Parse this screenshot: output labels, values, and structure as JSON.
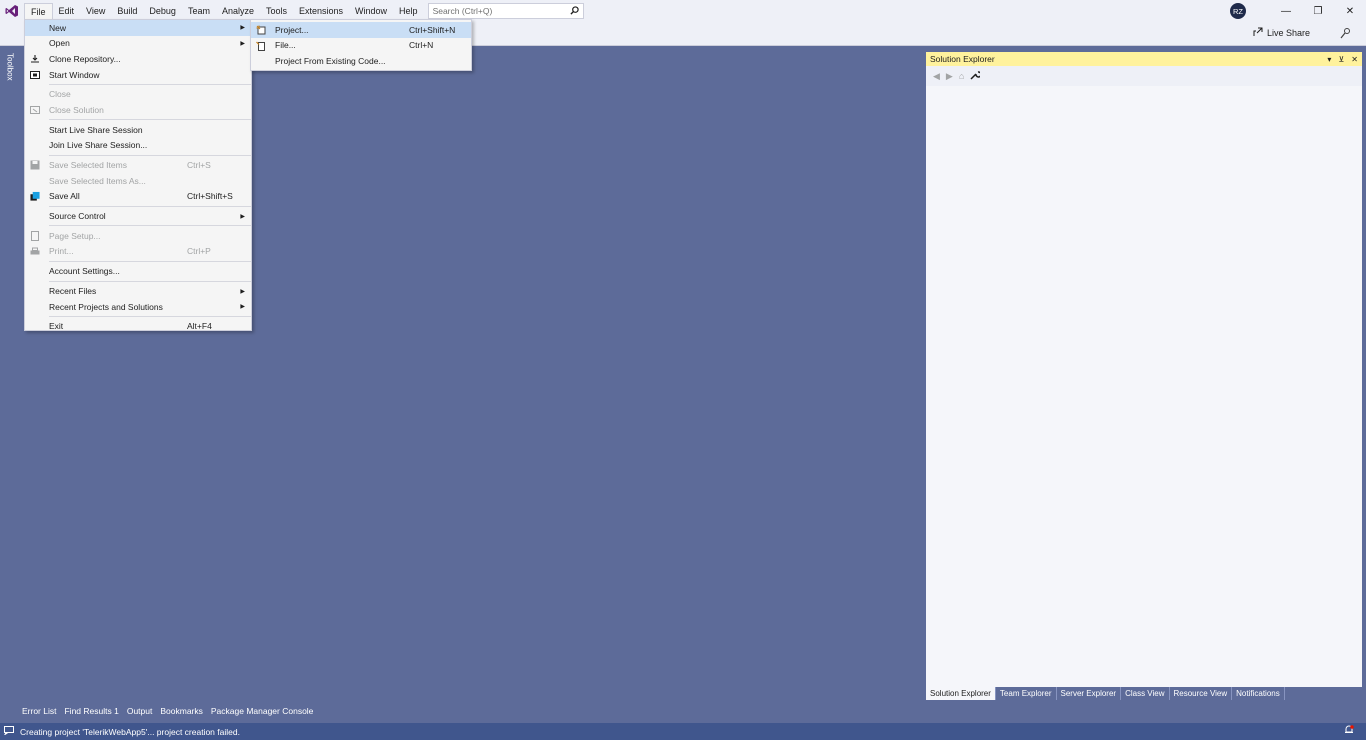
{
  "menubar": {
    "items": [
      "File",
      "Edit",
      "View",
      "Build",
      "Debug",
      "Team",
      "Analyze",
      "Tools",
      "Extensions",
      "Window",
      "Help"
    ],
    "search_placeholder": "Search (Ctrl+Q)"
  },
  "title_right": {
    "avatar_initials": "RZ",
    "live_share_label": "Live Share"
  },
  "toolbox": {
    "label": "Toolbox"
  },
  "file_menu": {
    "new": "New",
    "open": "Open",
    "clone_repository": "Clone Repository...",
    "start_window": "Start Window",
    "close": "Close",
    "close_solution": "Close Solution",
    "start_live_share": "Start Live Share Session",
    "join_live_share": "Join Live Share Session...",
    "save_selected": "Save Selected Items",
    "save_selected_shortcut": "Ctrl+S",
    "save_selected_as": "Save Selected Items As...",
    "save_all": "Save All",
    "save_all_shortcut": "Ctrl+Shift+S",
    "source_control": "Source Control",
    "page_setup": "Page Setup...",
    "print": "Print...",
    "print_shortcut": "Ctrl+P",
    "account_settings": "Account Settings...",
    "recent_files": "Recent Files",
    "recent_projects": "Recent Projects and Solutions",
    "exit": "Exit",
    "exit_shortcut": "Alt+F4"
  },
  "new_menu": {
    "project": "Project...",
    "project_shortcut": "Ctrl+Shift+N",
    "file": "File...",
    "file_shortcut": "Ctrl+N",
    "from_existing": "Project From Existing Code..."
  },
  "solution_explorer": {
    "title": "Solution Explorer"
  },
  "solution_tabs": [
    "Solution Explorer",
    "Team Explorer",
    "Server Explorer",
    "Class View",
    "Resource View",
    "Notifications"
  ],
  "bottom_tabs": [
    "Error List",
    "Find Results 1",
    "Output",
    "Bookmarks",
    "Package Manager Console"
  ],
  "status": {
    "message": "Creating project 'TelerikWebApp5'... project creation failed."
  },
  "colors": {
    "workspace": "#5d6b99",
    "chrome": "#eef0f7",
    "menu_highlight": "#c9def5",
    "panel_header_active": "#fff29d",
    "statusbar": "#40568d"
  }
}
